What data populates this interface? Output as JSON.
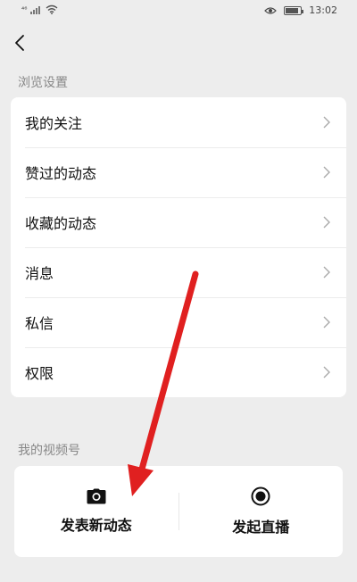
{
  "status_bar": {
    "signal_text": "⁴⁶",
    "time": "13:02",
    "battery_level": 0.85
  },
  "nav": {
    "back_icon": "chevron-left-icon"
  },
  "browse_settings": {
    "title": "浏览设置",
    "items": [
      {
        "label": "我的关注"
      },
      {
        "label": "赞过的动态"
      },
      {
        "label": "收藏的动态"
      },
      {
        "label": "消息"
      },
      {
        "label": "私信"
      },
      {
        "label": "权限"
      }
    ]
  },
  "my_channel": {
    "title": "我的视频号",
    "post_label": "发表新动态",
    "post_icon": "camera-icon",
    "live_label": "发起直播",
    "live_icon": "record-icon"
  },
  "annotation": {
    "arrow_color": "#e02020"
  }
}
